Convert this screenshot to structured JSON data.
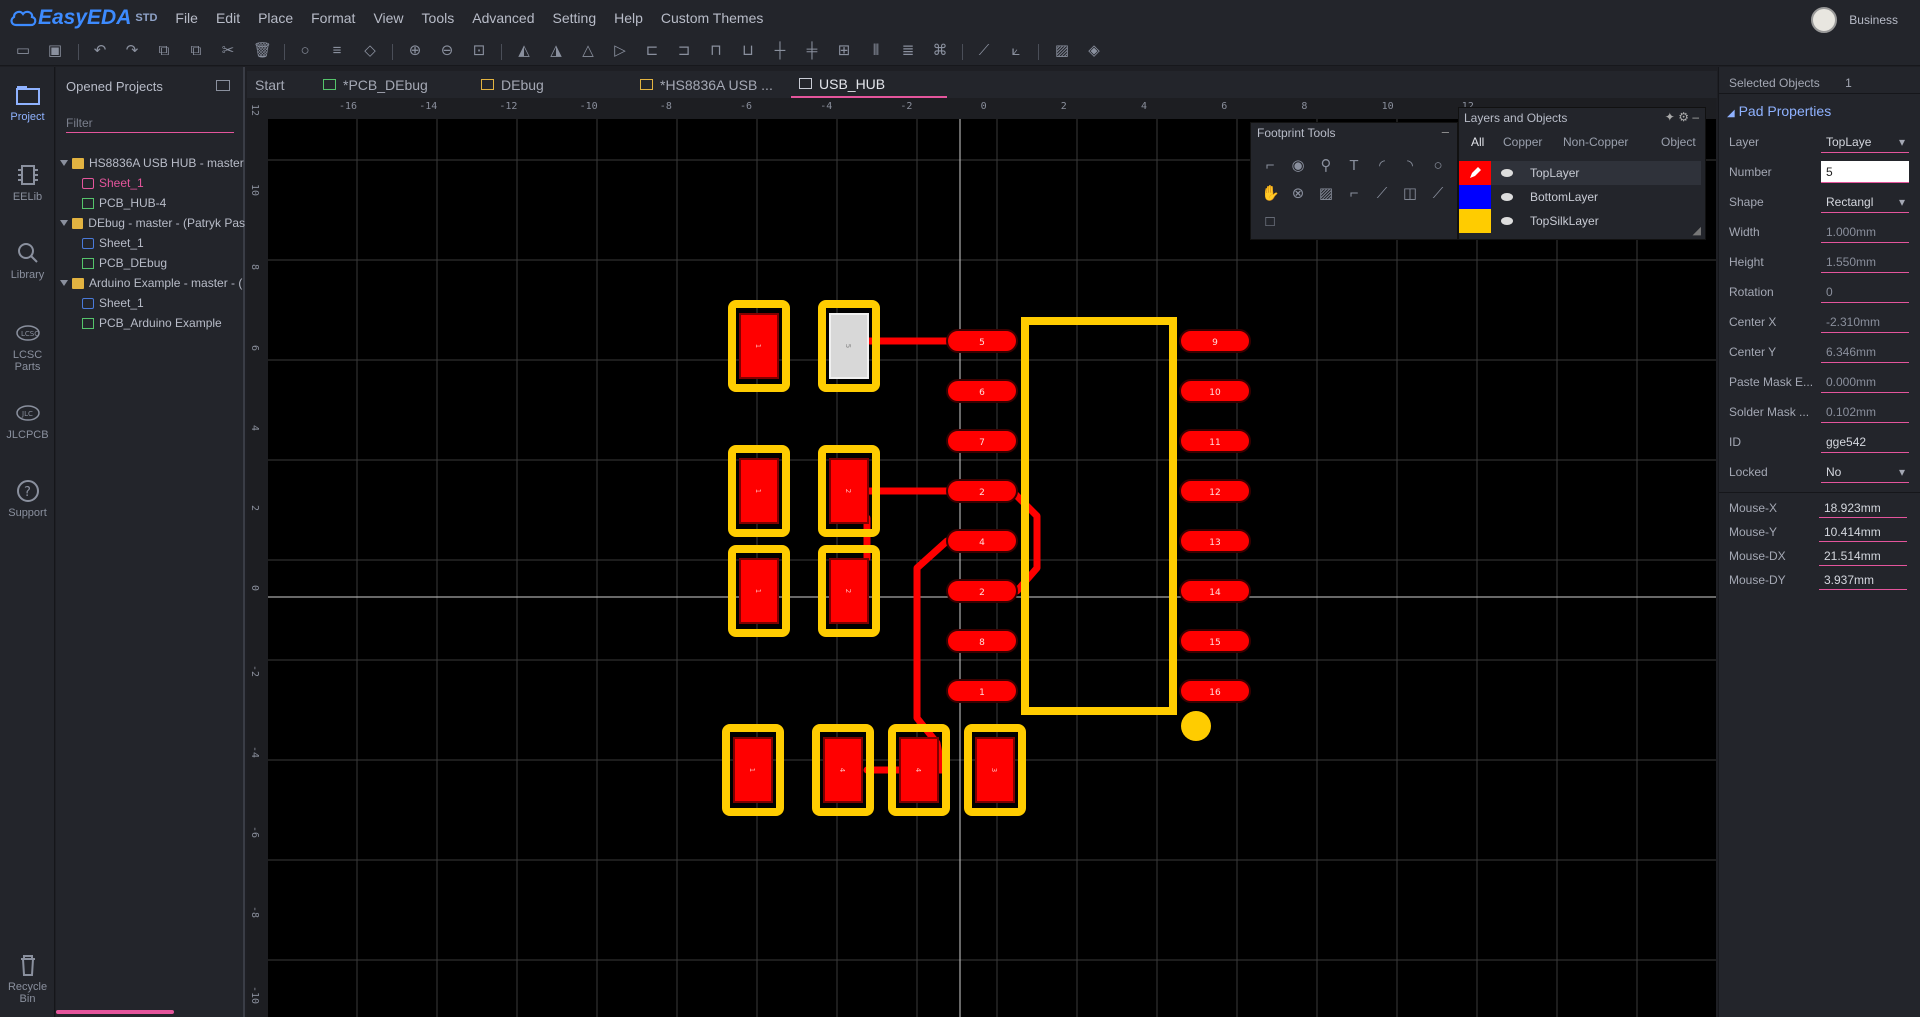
{
  "app": {
    "logo_text": "EasyEDA",
    "logo_suffix": "STD",
    "menu": [
      "File",
      "Edit",
      "Place",
      "Format",
      "View",
      "Tools",
      "Advanced",
      "Setting",
      "Help",
      "Custom Themes"
    ],
    "user_name": "Business"
  },
  "leftnav": {
    "items": [
      {
        "label": "Project"
      },
      {
        "label": "EELib"
      },
      {
        "label": "Library"
      },
      {
        "label": "LCSC Parts"
      },
      {
        "label": "JLCPCB"
      },
      {
        "label": "Support"
      },
      {
        "label": "Recycle Bin"
      }
    ]
  },
  "projects": {
    "title": "Opened Projects",
    "filter_placeholder": "Filter",
    "tree": [
      {
        "label": "HS8836A USB HUB - master",
        "type": "folder"
      },
      {
        "label": "Sheet_1",
        "type": "sch"
      },
      {
        "label": "PCB_HUB-4",
        "type": "pcb"
      },
      {
        "label": "DEbug - master - (Patryk Pas",
        "type": "folder"
      },
      {
        "label": "Sheet_1",
        "type": "sch"
      },
      {
        "label": "PCB_DEbug",
        "type": "pcb"
      },
      {
        "label": "Arduino Example - master - (",
        "type": "folder"
      },
      {
        "label": "Sheet_1",
        "type": "sch"
      },
      {
        "label": "PCB_Arduino Example",
        "type": "pcb"
      }
    ]
  },
  "tabs": [
    {
      "label": "Start"
    },
    {
      "label": "*PCB_DEbug"
    },
    {
      "label": "DEbug"
    },
    {
      "label": "*HS8836A USB ..."
    },
    {
      "label": "USB_HUB"
    }
  ],
  "ruler": {
    "top_labels": [
      "-16",
      "-14",
      "-12",
      "-10",
      "-8",
      "-6",
      "-4",
      "-2",
      "0",
      "2",
      "4",
      "6",
      "8",
      "10",
      "12"
    ],
    "left_labels": [
      "12",
      "10",
      "8",
      "6",
      "4",
      "2",
      "0",
      "-2",
      "-4",
      "-6",
      "-8",
      "-10"
    ]
  },
  "footprint_tools": {
    "title": "Footprint Tools"
  },
  "layers_panel": {
    "title": "Layers and Objects",
    "tabs": [
      "All",
      "Copper",
      "Non-Copper",
      "Object"
    ],
    "layers": [
      {
        "name": "TopLayer",
        "color": "#ff0000"
      },
      {
        "name": "BottomLayer",
        "color": "#0000ff"
      },
      {
        "name": "TopSilkLayer",
        "color": "#ffcc00"
      }
    ]
  },
  "pcb": {
    "top_pads": [
      "5",
      "6",
      "7",
      "2",
      "4",
      "2",
      "8",
      "1"
    ],
    "right_pads": [
      "9",
      "10",
      "11",
      "12",
      "13",
      "14",
      "15",
      "16"
    ],
    "small_pad_labels": [
      "1",
      "5",
      "1",
      "2",
      "1",
      "2",
      "1",
      "4",
      "4",
      "3"
    ]
  },
  "properties": {
    "selected_label": "Selected Objects",
    "selected_count": "1",
    "section_title": "Pad Properties",
    "rows": [
      {
        "label": "Layer",
        "value": "TopLaye"
      },
      {
        "label": "Number",
        "value": "5"
      },
      {
        "label": "Shape",
        "value": "Rectangl"
      },
      {
        "label": "Width",
        "value": "1.000mm"
      },
      {
        "label": "Height",
        "value": "1.550mm"
      },
      {
        "label": "Rotation",
        "value": "0"
      },
      {
        "label": "Center X",
        "value": "-2.310mm"
      },
      {
        "label": "Center Y",
        "value": "6.346mm"
      },
      {
        "label": "Paste Mask E...",
        "value": "0.000mm"
      },
      {
        "label": "Solder Mask ...",
        "value": "0.102mm"
      },
      {
        "label": "ID",
        "value": "gge542"
      },
      {
        "label": "Locked",
        "value": "No"
      }
    ],
    "mouse": [
      {
        "label": "Mouse-X",
        "value": "18.923mm"
      },
      {
        "label": "Mouse-Y",
        "value": "10.414mm"
      },
      {
        "label": "Mouse-DX",
        "value": "21.514mm"
      },
      {
        "label": "Mouse-DY",
        "value": "3.937mm"
      }
    ]
  }
}
